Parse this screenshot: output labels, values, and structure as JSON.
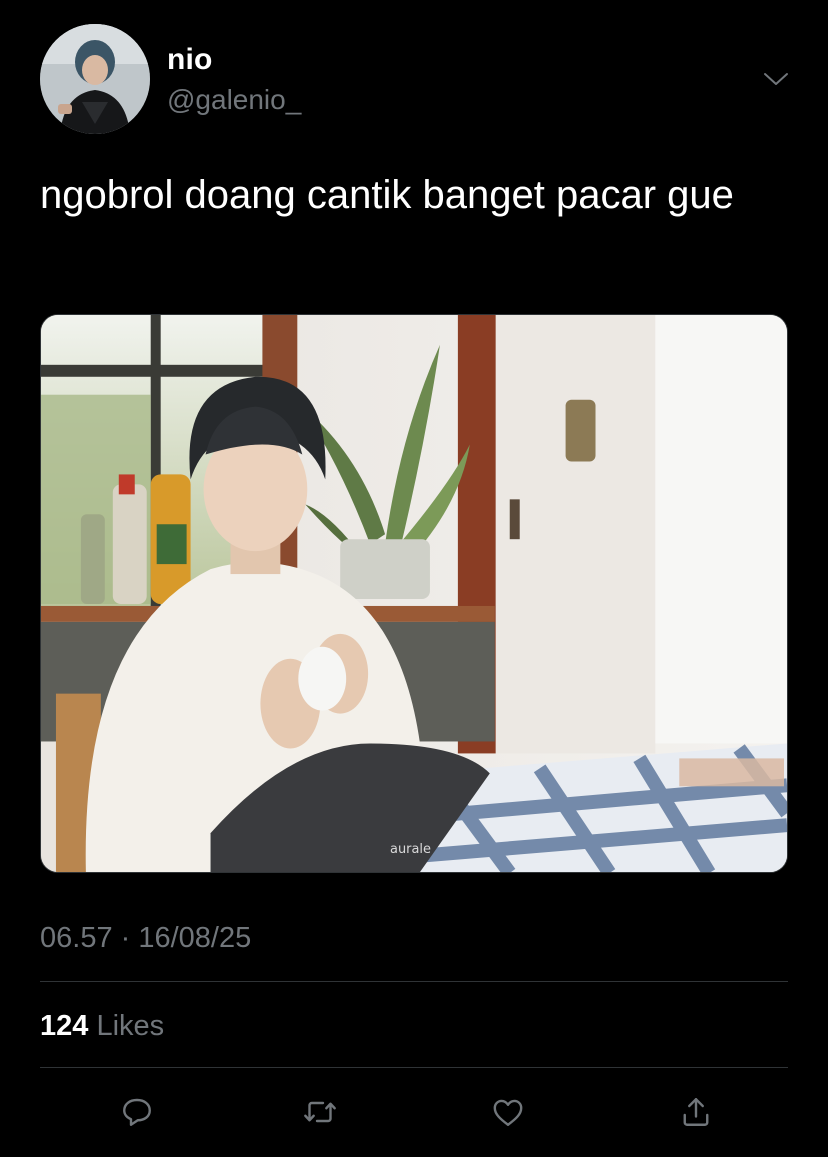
{
  "author": {
    "display_name": "nio",
    "handle": "@galenio_",
    "avatar_icon": "profile-photo"
  },
  "tweet": {
    "text": "ngobrol doang cantik banget pacar gue",
    "media_watermark": "aurale"
  },
  "meta": {
    "timestamp": "06.57 · 16/08/25"
  },
  "stats": {
    "likes_count": "124",
    "likes_label": "Likes"
  },
  "actions": [
    {
      "icon": "reply-icon"
    },
    {
      "icon": "retweet-icon"
    },
    {
      "icon": "like-icon"
    },
    {
      "icon": "share-icon"
    }
  ],
  "colors": {
    "background": "#000000",
    "primary_text": "#ffffff",
    "secondary_text": "#71767b",
    "divider": "#2f3336"
  }
}
